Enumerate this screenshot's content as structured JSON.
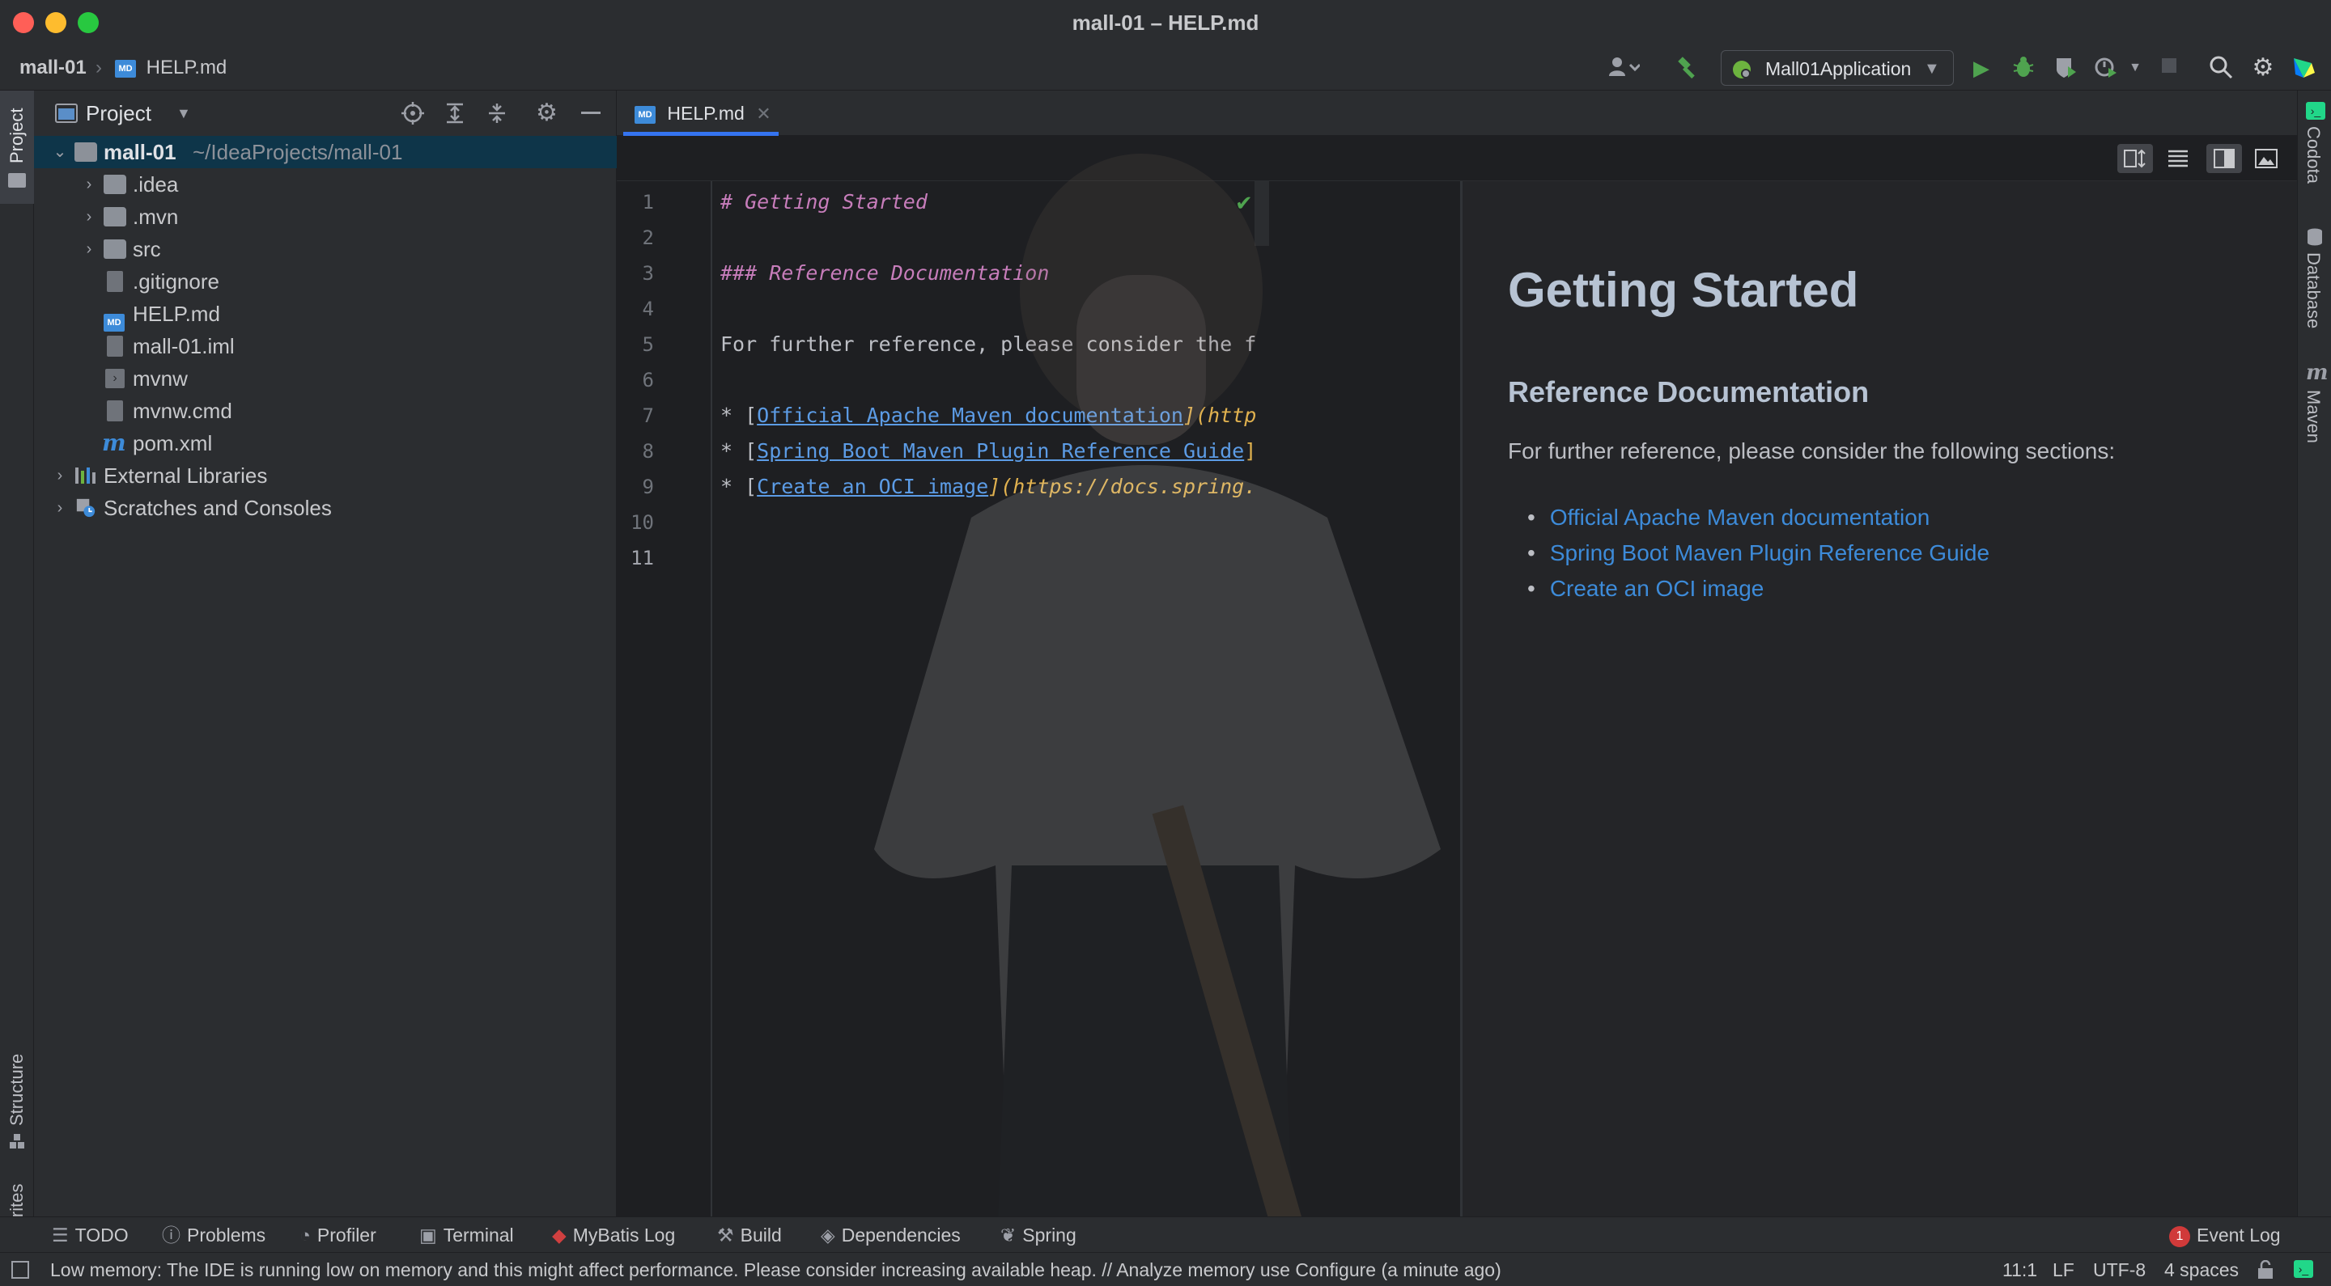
{
  "window": {
    "title": "mall-01 – HELP.md"
  },
  "navbar": {
    "project": "mall-01",
    "file_badge": "MD",
    "file": "HELP.md",
    "run_config": "Mall01Application"
  },
  "project_panel": {
    "title": "Project",
    "tree": [
      {
        "label": "mall-01",
        "path": "~/IdeaProjects/mall-01"
      },
      {
        "label": ".idea"
      },
      {
        "label": ".mvn"
      },
      {
        "label": "src"
      },
      {
        "label": ".gitignore"
      },
      {
        "label": "HELP.md"
      },
      {
        "label": "mall-01.iml"
      },
      {
        "label": "mvnw"
      },
      {
        "label": "mvnw.cmd"
      },
      {
        "label": "pom.xml"
      },
      {
        "label": "External Libraries"
      },
      {
        "label": "Scratches and Consoles"
      }
    ]
  },
  "left_strip": {
    "project": "Project",
    "structure": "Structure",
    "favorites": "Favorites"
  },
  "right_strip": {
    "codota": "Codota",
    "database": "Database",
    "maven": "Maven"
  },
  "editor": {
    "tab": "HELP.md",
    "line_numbers": [
      "1",
      "2",
      "3",
      "4",
      "5",
      "6",
      "7",
      "8",
      "9",
      "10",
      "11"
    ],
    "code": {
      "l1": "# Getting Started",
      "l3": "### Reference Documentation",
      "l5": "For further reference, please consider the f",
      "l7_pre": "* [",
      "l7_link": "Official Apache Maven documentation",
      "l7_post": "](http",
      "l8_pre": "* [",
      "l8_link": "Spring Boot Maven Plugin Reference Guide",
      "l8_post": "]",
      "l9_pre": "* [",
      "l9_link": "Create an OCI image",
      "l9_post": "](https://docs.spring."
    }
  },
  "preview": {
    "h1": "Getting Started",
    "h3": "Reference Documentation",
    "para": "For further reference, please consider the following sections:",
    "links": [
      "Official Apache Maven documentation",
      "Spring Boot Maven Plugin Reference Guide",
      "Create an OCI image"
    ]
  },
  "tool_tabs": {
    "todo": "TODO",
    "problems": "Problems",
    "profiler": "Profiler",
    "terminal": "Terminal",
    "mybatis": "MyBatis Log",
    "build": "Build",
    "dependencies": "Dependencies",
    "spring": "Spring",
    "event_log_count": "1",
    "event_log": "Event Log"
  },
  "status": {
    "message": "Low memory: The IDE is running low on memory and this might affect performance. Please consider increasing available heap. // Analyze memory use   Configure (a minute ago)",
    "position": "11:1",
    "line_sep": "LF",
    "encoding": "UTF-8",
    "indent": "4 spaces"
  },
  "colors": {
    "accent": "#3574f0",
    "link": "#3d8bd9",
    "run_green": "#4fa34f",
    "traffic_red": "#ff5f57",
    "traffic_yellow": "#febc2e",
    "traffic_green": "#28c840"
  }
}
